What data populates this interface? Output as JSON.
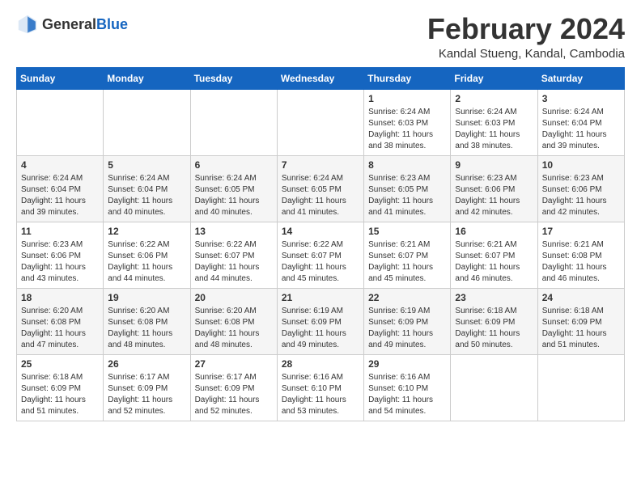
{
  "header": {
    "logo_general": "General",
    "logo_blue": "Blue",
    "main_title": "February 2024",
    "subtitle": "Kandal Stueng, Kandal, Cambodia"
  },
  "weekdays": [
    "Sunday",
    "Monday",
    "Tuesday",
    "Wednesday",
    "Thursday",
    "Friday",
    "Saturday"
  ],
  "weeks": [
    [
      {
        "day": "",
        "sunrise": "",
        "sunset": "",
        "daylight": ""
      },
      {
        "day": "",
        "sunrise": "",
        "sunset": "",
        "daylight": ""
      },
      {
        "day": "",
        "sunrise": "",
        "sunset": "",
        "daylight": ""
      },
      {
        "day": "",
        "sunrise": "",
        "sunset": "",
        "daylight": ""
      },
      {
        "day": "1",
        "sunrise": "Sunrise: 6:24 AM",
        "sunset": "Sunset: 6:03 PM",
        "daylight": "Daylight: 11 hours and 38 minutes."
      },
      {
        "day": "2",
        "sunrise": "Sunrise: 6:24 AM",
        "sunset": "Sunset: 6:03 PM",
        "daylight": "Daylight: 11 hours and 38 minutes."
      },
      {
        "day": "3",
        "sunrise": "Sunrise: 6:24 AM",
        "sunset": "Sunset: 6:04 PM",
        "daylight": "Daylight: 11 hours and 39 minutes."
      }
    ],
    [
      {
        "day": "4",
        "sunrise": "Sunrise: 6:24 AM",
        "sunset": "Sunset: 6:04 PM",
        "daylight": "Daylight: 11 hours and 39 minutes."
      },
      {
        "day": "5",
        "sunrise": "Sunrise: 6:24 AM",
        "sunset": "Sunset: 6:04 PM",
        "daylight": "Daylight: 11 hours and 40 minutes."
      },
      {
        "day": "6",
        "sunrise": "Sunrise: 6:24 AM",
        "sunset": "Sunset: 6:05 PM",
        "daylight": "Daylight: 11 hours and 40 minutes."
      },
      {
        "day": "7",
        "sunrise": "Sunrise: 6:24 AM",
        "sunset": "Sunset: 6:05 PM",
        "daylight": "Daylight: 11 hours and 41 minutes."
      },
      {
        "day": "8",
        "sunrise": "Sunrise: 6:23 AM",
        "sunset": "Sunset: 6:05 PM",
        "daylight": "Daylight: 11 hours and 41 minutes."
      },
      {
        "day": "9",
        "sunrise": "Sunrise: 6:23 AM",
        "sunset": "Sunset: 6:06 PM",
        "daylight": "Daylight: 11 hours and 42 minutes."
      },
      {
        "day": "10",
        "sunrise": "Sunrise: 6:23 AM",
        "sunset": "Sunset: 6:06 PM",
        "daylight": "Daylight: 11 hours and 42 minutes."
      }
    ],
    [
      {
        "day": "11",
        "sunrise": "Sunrise: 6:23 AM",
        "sunset": "Sunset: 6:06 PM",
        "daylight": "Daylight: 11 hours and 43 minutes."
      },
      {
        "day": "12",
        "sunrise": "Sunrise: 6:22 AM",
        "sunset": "Sunset: 6:06 PM",
        "daylight": "Daylight: 11 hours and 44 minutes."
      },
      {
        "day": "13",
        "sunrise": "Sunrise: 6:22 AM",
        "sunset": "Sunset: 6:07 PM",
        "daylight": "Daylight: 11 hours and 44 minutes."
      },
      {
        "day": "14",
        "sunrise": "Sunrise: 6:22 AM",
        "sunset": "Sunset: 6:07 PM",
        "daylight": "Daylight: 11 hours and 45 minutes."
      },
      {
        "day": "15",
        "sunrise": "Sunrise: 6:21 AM",
        "sunset": "Sunset: 6:07 PM",
        "daylight": "Daylight: 11 hours and 45 minutes."
      },
      {
        "day": "16",
        "sunrise": "Sunrise: 6:21 AM",
        "sunset": "Sunset: 6:07 PM",
        "daylight": "Daylight: 11 hours and 46 minutes."
      },
      {
        "day": "17",
        "sunrise": "Sunrise: 6:21 AM",
        "sunset": "Sunset: 6:08 PM",
        "daylight": "Daylight: 11 hours and 46 minutes."
      }
    ],
    [
      {
        "day": "18",
        "sunrise": "Sunrise: 6:20 AM",
        "sunset": "Sunset: 6:08 PM",
        "daylight": "Daylight: 11 hours and 47 minutes."
      },
      {
        "day": "19",
        "sunrise": "Sunrise: 6:20 AM",
        "sunset": "Sunset: 6:08 PM",
        "daylight": "Daylight: 11 hours and 48 minutes."
      },
      {
        "day": "20",
        "sunrise": "Sunrise: 6:20 AM",
        "sunset": "Sunset: 6:08 PM",
        "daylight": "Daylight: 11 hours and 48 minutes."
      },
      {
        "day": "21",
        "sunrise": "Sunrise: 6:19 AM",
        "sunset": "Sunset: 6:09 PM",
        "daylight": "Daylight: 11 hours and 49 minutes."
      },
      {
        "day": "22",
        "sunrise": "Sunrise: 6:19 AM",
        "sunset": "Sunset: 6:09 PM",
        "daylight": "Daylight: 11 hours and 49 minutes."
      },
      {
        "day": "23",
        "sunrise": "Sunrise: 6:18 AM",
        "sunset": "Sunset: 6:09 PM",
        "daylight": "Daylight: 11 hours and 50 minutes."
      },
      {
        "day": "24",
        "sunrise": "Sunrise: 6:18 AM",
        "sunset": "Sunset: 6:09 PM",
        "daylight": "Daylight: 11 hours and 51 minutes."
      }
    ],
    [
      {
        "day": "25",
        "sunrise": "Sunrise: 6:18 AM",
        "sunset": "Sunset: 6:09 PM",
        "daylight": "Daylight: 11 hours and 51 minutes."
      },
      {
        "day": "26",
        "sunrise": "Sunrise: 6:17 AM",
        "sunset": "Sunset: 6:09 PM",
        "daylight": "Daylight: 11 hours and 52 minutes."
      },
      {
        "day": "27",
        "sunrise": "Sunrise: 6:17 AM",
        "sunset": "Sunset: 6:09 PM",
        "daylight": "Daylight: 11 hours and 52 minutes."
      },
      {
        "day": "28",
        "sunrise": "Sunrise: 6:16 AM",
        "sunset": "Sunset: 6:10 PM",
        "daylight": "Daylight: 11 hours and 53 minutes."
      },
      {
        "day": "29",
        "sunrise": "Sunrise: 6:16 AM",
        "sunset": "Sunset: 6:10 PM",
        "daylight": "Daylight: 11 hours and 54 minutes."
      },
      {
        "day": "",
        "sunrise": "",
        "sunset": "",
        "daylight": ""
      },
      {
        "day": "",
        "sunrise": "",
        "sunset": "",
        "daylight": ""
      }
    ]
  ]
}
